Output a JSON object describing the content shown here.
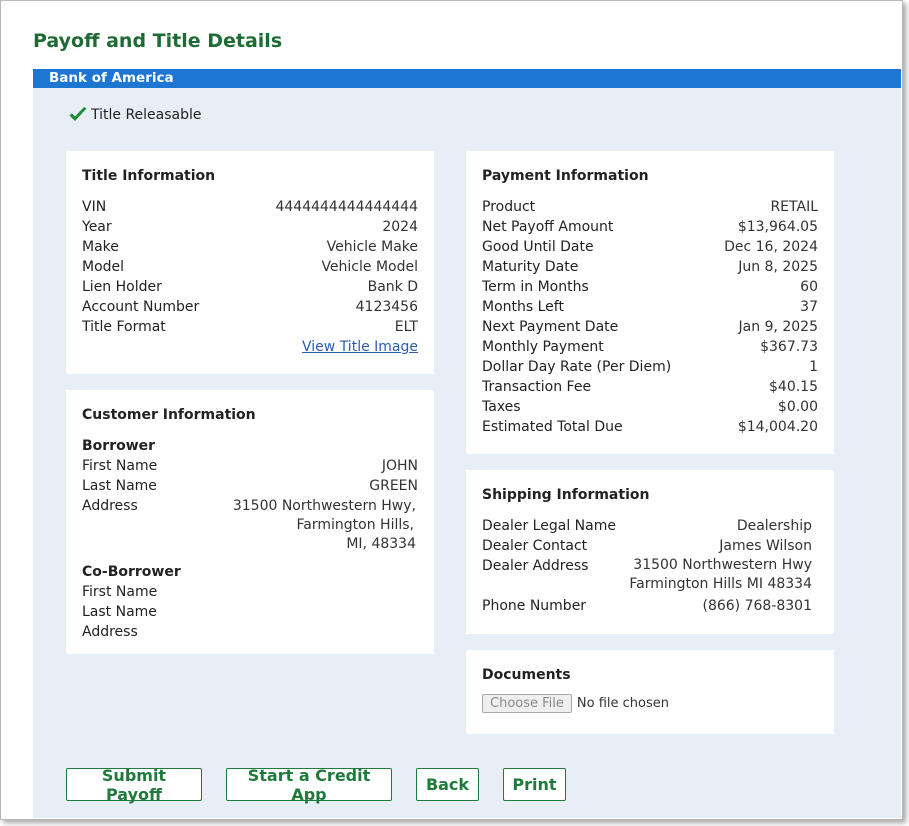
{
  "page_title": "Payoff and Title Details",
  "bank_name": "Bank of America",
  "title_status": "Title Releasable",
  "title_info": {
    "heading": "Title Information",
    "rows": [
      {
        "label": "VIN",
        "value": "4444444444444444"
      },
      {
        "label": "Year",
        "value": "2024"
      },
      {
        "label": "Make",
        "value": "Vehicle Make"
      },
      {
        "label": "Model",
        "value": "Vehicle Model"
      },
      {
        "label": "Lien Holder",
        "value": "Bank D"
      },
      {
        "label": "Account Number",
        "value": "4123456"
      },
      {
        "label": "Title Format",
        "value": "ELT"
      }
    ],
    "view_link": "View Title Image"
  },
  "customer_info": {
    "heading": "Customer Information",
    "borrower": {
      "heading": "Borrower",
      "first_name_label": "First Name",
      "first_name": "JOHN",
      "last_name_label": "Last Name",
      "last_name": "GREEN",
      "address_label": "Address",
      "address_line1": "31500 Northwestern Hwy,",
      "address_line2": "Farmington Hills,",
      "address_line3": "MI, 48334"
    },
    "co_borrower": {
      "heading": "Co-Borrower",
      "first_name_label": "First Name",
      "last_name_label": "Last Name",
      "address_label": "Address"
    }
  },
  "payment_info": {
    "heading": "Payment Information",
    "rows": [
      {
        "label": "Product",
        "value": "RETAIL"
      },
      {
        "label": "Net Payoff Amount",
        "value": "$13,964.05"
      },
      {
        "label": "Good Until Date",
        "value": "Dec 16, 2024"
      },
      {
        "label": "Maturity Date",
        "value": "Jun 8, 2025"
      },
      {
        "label": "Term in Months",
        "value": "60"
      },
      {
        "label": "Months Left",
        "value": "37"
      },
      {
        "label": "Next Payment Date",
        "value": "Jan 9, 2025"
      },
      {
        "label": "Monthly Payment",
        "value": "$367.73"
      },
      {
        "label": "Dollar Day Rate (Per Diem)",
        "value": "1"
      },
      {
        "label": "Transaction Fee",
        "value": "$40.15"
      },
      {
        "label": "Taxes",
        "value": "$0.00"
      },
      {
        "label": "Estimated Total Due",
        "value": "$14,004.20"
      }
    ]
  },
  "shipping_info": {
    "heading": "Shipping Information",
    "dealer_legal_name_label": "Dealer Legal Name",
    "dealer_legal_name": "Dealership",
    "dealer_contact_label": "Dealer Contact",
    "dealer_contact": "James Wilson",
    "dealer_address_label": "Dealer Address",
    "dealer_address_line1": "31500 Northwestern Hwy",
    "dealer_address_line2": "Farmington Hills MI 48334",
    "phone_label": "Phone Number",
    "phone": "(866) 768-8301"
  },
  "documents": {
    "heading": "Documents",
    "choose_file_label": "Choose File",
    "no_file_text": "No file chosen"
  },
  "buttons": {
    "submit": "Submit Payoff",
    "credit_app": "Start a Credit App",
    "back": "Back",
    "print": "Print"
  },
  "colors": {
    "title_green": "#1f6b34",
    "bank_bar_blue": "#1d77d2",
    "content_bg": "#e8eef6",
    "check_green": "#1f8a3c",
    "button_green": "#1f7a3b"
  },
  "icons": {
    "status": "checkmark-icon"
  }
}
